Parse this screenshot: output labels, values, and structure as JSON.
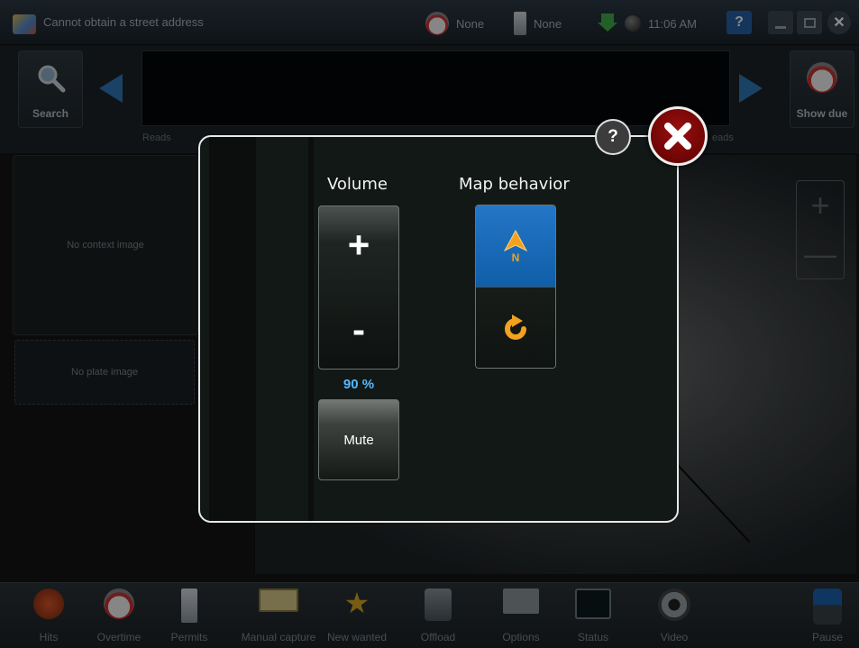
{
  "titlebar": {
    "address": "Cannot obtain a street address",
    "status1": "None",
    "status2": "None",
    "time": "11:06 AM",
    "help_label": "?",
    "close_label": "✕"
  },
  "toolbar": {
    "search_label": "Search",
    "show_due_label": "Show due",
    "reads_left": "Reads",
    "reads_right": "eads"
  },
  "left": {
    "context_text": "No context image",
    "plate_text": "No plate image"
  },
  "map": {
    "zoom_in": "+",
    "zoom_out": "—"
  },
  "dialog": {
    "volume_title": "Volume",
    "map_title": "Map behavior",
    "plus": "+",
    "minus": "-",
    "volume_percent": "90 %",
    "volume_level": 0.9,
    "mute_label": "Mute",
    "help_label": "?",
    "north_letter": "N"
  },
  "bottom": {
    "items": [
      "Hits",
      "Overtime",
      "Permits",
      "Manual capture",
      "New wanted",
      "Offload",
      "Options",
      "Status",
      "Video",
      "Pause"
    ]
  },
  "colors": {
    "accent_blue": "#1565b8",
    "volume_text": "#57b8ff",
    "close_red": "#7a0606",
    "arrow_orange": "#f0a020"
  }
}
